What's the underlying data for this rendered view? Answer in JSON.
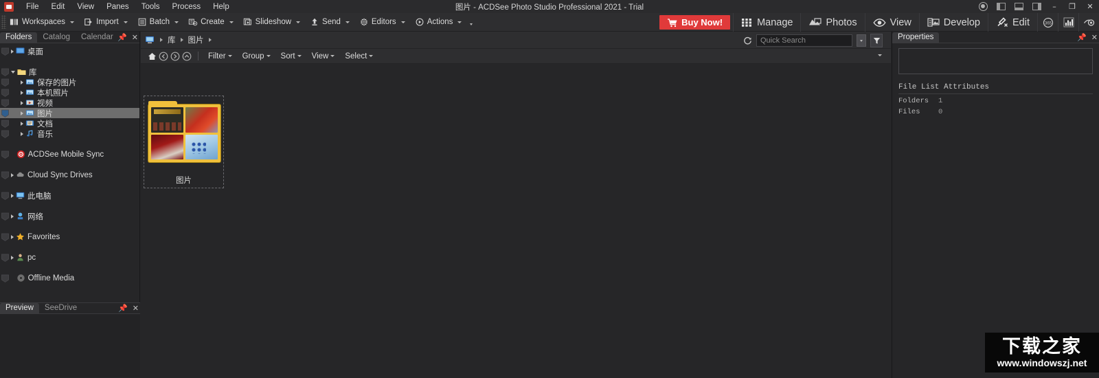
{
  "titlebar": {
    "title": "图片 - ACDSee Photo Studio Professional 2021 - Trial",
    "menus": [
      "File",
      "Edit",
      "View",
      "Panes",
      "Tools",
      "Process",
      "Help"
    ],
    "window_controls": {
      "minimize": "–",
      "restore": "❐",
      "close": "✕"
    },
    "icons": {
      "app": "acdsee-logo-icon",
      "account": "account-icon",
      "layout_left": "layout-left-panel-icon",
      "layout_bottom": "layout-bottom-panel-icon",
      "layout_right": "layout-right-panel-icon"
    }
  },
  "toolbar": {
    "items": [
      {
        "label": "Workspaces",
        "icon": "workspaces-icon",
        "caret": true
      },
      {
        "label": "Import",
        "icon": "import-icon",
        "caret": true
      },
      {
        "label": "Batch",
        "icon": "batch-icon",
        "caret": true
      },
      {
        "label": "Create",
        "icon": "create-icon",
        "caret": true
      },
      {
        "label": "Slideshow",
        "icon": "slideshow-icon",
        "caret": true
      },
      {
        "label": "Send",
        "icon": "send-icon",
        "caret": true
      },
      {
        "label": "Editors",
        "icon": "editors-icon",
        "caret": true
      },
      {
        "label": "Actions",
        "icon": "actions-icon",
        "caret": true
      }
    ],
    "overflow_caret": "overflow-chevron-icon",
    "buy_now": {
      "label": "Buy Now!",
      "icon": "cart-icon",
      "color": "#e03a3a"
    },
    "modes": [
      {
        "label": "Manage",
        "icon": "grid-icon"
      },
      {
        "label": "Photos",
        "icon": "photos-icon"
      },
      {
        "label": "View",
        "icon": "eye-icon"
      },
      {
        "label": "Develop",
        "icon": "develop-icon"
      },
      {
        "label": "Edit",
        "icon": "edit-brush-icon"
      }
    ],
    "extras": [
      {
        "icon": "365-circle-icon",
        "label": "365"
      },
      {
        "icon": "bar-chart-icon",
        "label": ""
      },
      {
        "icon": "eye-compare-icon",
        "label": ""
      }
    ]
  },
  "left_pane": {
    "tabs": [
      {
        "label": "Folders",
        "active": true
      },
      {
        "label": "Catalog",
        "active": false
      },
      {
        "label": "Calendar",
        "active": false
      }
    ],
    "pin_icon": "pin-icon",
    "close_icon": "close-icon",
    "tree": [
      {
        "label": "桌面",
        "depth": 1,
        "arrow": "closed",
        "icon": "desktop-icon",
        "selected": false,
        "badge": true
      },
      {
        "label": "",
        "depth": 1,
        "arrow": "none",
        "icon": "spacer",
        "selected": false,
        "badge": false
      },
      {
        "label": "库",
        "depth": 1,
        "arrow": "open",
        "icon": "library-folder-icon",
        "selected": false,
        "badge": true
      },
      {
        "label": "保存的图片",
        "depth": 2,
        "arrow": "closed",
        "icon": "saved-pictures-icon",
        "selected": false,
        "badge": true
      },
      {
        "label": "本机照片",
        "depth": 2,
        "arrow": "closed",
        "icon": "local-photos-icon",
        "selected": false,
        "badge": true
      },
      {
        "label": "视频",
        "depth": 2,
        "arrow": "closed",
        "icon": "videos-icon",
        "selected": false,
        "badge": true
      },
      {
        "label": "图片",
        "depth": 2,
        "arrow": "closed",
        "icon": "pictures-icon",
        "selected": true,
        "badge": true
      },
      {
        "label": "文档",
        "depth": 2,
        "arrow": "closed",
        "icon": "documents-icon",
        "selected": false,
        "badge": true
      },
      {
        "label": "音乐",
        "depth": 2,
        "arrow": "closed",
        "icon": "music-icon",
        "selected": false,
        "badge": true
      },
      {
        "label": "",
        "depth": 1,
        "arrow": "none",
        "icon": "spacer",
        "selected": false,
        "badge": false
      },
      {
        "label": "ACDSee Mobile Sync",
        "depth": 1,
        "arrow": "none",
        "icon": "mobile-sync-icon",
        "selected": false,
        "badge": true
      },
      {
        "label": "",
        "depth": 1,
        "arrow": "none",
        "icon": "spacer",
        "selected": false,
        "badge": false
      },
      {
        "label": "Cloud Sync Drives",
        "depth": 1,
        "arrow": "closed",
        "icon": "cloud-icon",
        "selected": false,
        "badge": true
      },
      {
        "label": "",
        "depth": 1,
        "arrow": "none",
        "icon": "spacer",
        "selected": false,
        "badge": false
      },
      {
        "label": "此电脑",
        "depth": 1,
        "arrow": "closed",
        "icon": "this-pc-icon",
        "selected": false,
        "badge": true
      },
      {
        "label": "",
        "depth": 1,
        "arrow": "none",
        "icon": "spacer",
        "selected": false,
        "badge": false
      },
      {
        "label": "网络",
        "depth": 1,
        "arrow": "closed",
        "icon": "network-icon",
        "selected": false,
        "badge": true
      },
      {
        "label": "",
        "depth": 1,
        "arrow": "none",
        "icon": "spacer",
        "selected": false,
        "badge": false
      },
      {
        "label": "Favorites",
        "depth": 1,
        "arrow": "closed",
        "icon": "star-icon",
        "selected": false,
        "badge": true
      },
      {
        "label": "",
        "depth": 1,
        "arrow": "none",
        "icon": "spacer",
        "selected": false,
        "badge": false
      },
      {
        "label": "pc",
        "depth": 1,
        "arrow": "closed",
        "icon": "user-icon",
        "selected": false,
        "badge": true
      },
      {
        "label": "",
        "depth": 1,
        "arrow": "none",
        "icon": "spacer",
        "selected": false,
        "badge": false
      },
      {
        "label": "Offline Media",
        "depth": 1,
        "arrow": "none",
        "icon": "offline-media-icon",
        "selected": false,
        "badge": true
      }
    ],
    "preview": {
      "tabs": [
        {
          "label": "Preview",
          "active": true
        },
        {
          "label": "SeeDrive",
          "active": false
        }
      ]
    }
  },
  "center": {
    "breadcrumb": {
      "root_icon": "computer-icon",
      "items": [
        "库",
        "图片"
      ]
    },
    "search": {
      "refresh_icon": "refresh-icon",
      "placeholder": "Quick Search",
      "value": "",
      "dropdown_icon": "chevron-down-icon",
      "filter_icon": "filter-funnel-icon"
    },
    "controls": {
      "nav": [
        {
          "icon": "home-icon",
          "name": "home-button"
        },
        {
          "icon": "back-icon",
          "name": "back-button"
        },
        {
          "icon": "forward-icon",
          "name": "forward-button"
        },
        {
          "icon": "up-icon",
          "name": "up-button"
        }
      ],
      "menus": [
        "Filter",
        "Group",
        "Sort",
        "View",
        "Select"
      ],
      "overflow_icon": "chevron-down-icon"
    },
    "thumbnails": [
      {
        "label": "图片",
        "type": "folder",
        "selected": false
      }
    ]
  },
  "right_pane": {
    "tabs": [
      {
        "label": "Properties",
        "active": true
      }
    ],
    "pin_icon": "pin-icon",
    "close_icon": "close-icon",
    "section_title": "File List Attributes",
    "attributes": [
      {
        "key": "Folders",
        "value": "1"
      },
      {
        "key": "Files",
        "value": "0"
      }
    ]
  },
  "watermark": {
    "text_cn": "下载之家",
    "url": "www.windowszj.net"
  }
}
